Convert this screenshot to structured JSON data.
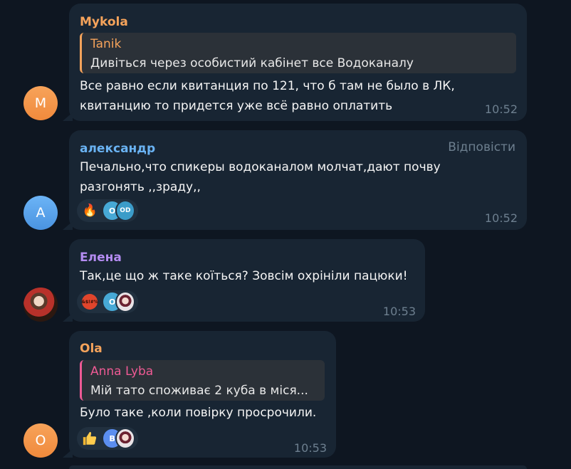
{
  "colors": {
    "background": "#0e1621",
    "bubble": "#182533",
    "author_mykola": "#f5a35b",
    "author_alexandr": "#6ab3f3",
    "author_elena": "#b48cf2",
    "author_ola": "#f5a35b",
    "quote_tanik": "#f5a35b",
    "quote_anna": "#ee5a94",
    "muted": "#6d7f8f"
  },
  "messages": [
    {
      "author": "Mykola",
      "avatar_letter": "M",
      "quote": {
        "author": "Tanik",
        "text": "Дивіться через особистий кабінет все Водоканалу"
      },
      "lines": [
        "Все равно если квитанция по 121, что б там не было в ЛК,",
        "квитанцию  то придется уже всё равно оплатить"
      ],
      "time": "10:52"
    },
    {
      "author": "александр",
      "avatar_letter": "A",
      "reply_label": "Відповісти",
      "lines": [
        "Печально,что спикеры водоканалом молчат,дают почву",
        "разгонять ,,зраду,,"
      ],
      "reactions": {
        "emoji": "🔥",
        "icon": "fire-icon",
        "avatars": [
          "O",
          "OD"
        ]
      },
      "time": "10:52"
    },
    {
      "author": "Елена",
      "lines": [
        "Так,це що ж таке коїться? Зовсім охрініли пацюки!"
      ],
      "reactions": {
        "emoji_text": "&$!#%",
        "icon": "cursing-face-icon",
        "avatars": [
          "O"
        ]
      },
      "time": "10:53"
    },
    {
      "author": "Ola",
      "avatar_letter": "O",
      "quote": {
        "author": "Anna Lyba",
        "text": "Мій тато споживає 2 куба в міся..."
      },
      "lines": [
        "Було таке ,коли повірку просрочили."
      ],
      "reactions": {
        "icon": "thumbs-up-icon",
        "avatars": [
          "B"
        ]
      },
      "time": "10:53"
    }
  ]
}
